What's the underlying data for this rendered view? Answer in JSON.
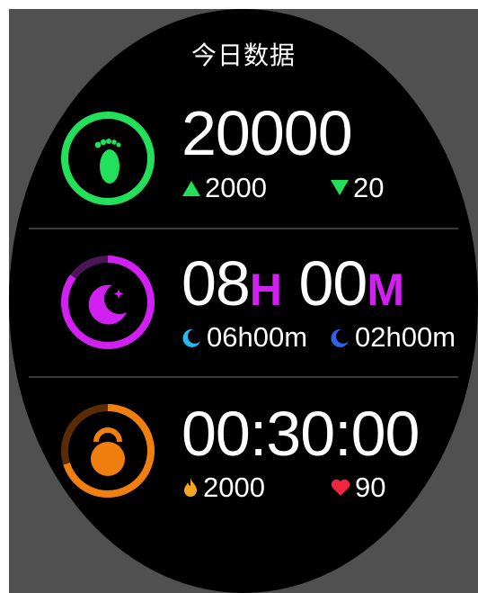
{
  "title": "今日数据",
  "steps": {
    "value": "20000",
    "up_value": "2000",
    "down_value": "20",
    "color": "#22e05a",
    "icon": "footprint-icon"
  },
  "sleep": {
    "hours": "08",
    "hours_unit": "H",
    "minutes": "00",
    "minutes_unit": "M",
    "deep_value": "06h00m",
    "light_value": "02h00m",
    "color": "#d21ff2",
    "deep_color": "#28b7f0",
    "light_color": "#2f62f0",
    "progress": 0.85,
    "icon": "moon-icon"
  },
  "workout": {
    "duration": "00:30:00",
    "calories": "2000",
    "heart_rate": "90",
    "color": "#f07f10",
    "track_color": "#5a2c06",
    "calorie_color": "#f5a623",
    "heart_color": "#f0263f",
    "progress": 0.7,
    "icon": "kettlebell-icon"
  }
}
